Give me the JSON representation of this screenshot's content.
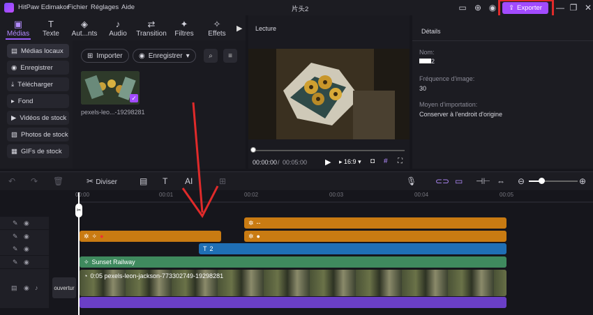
{
  "app": {
    "name": "HitPaw Edimakor",
    "menu": [
      "Fichier",
      "Réglages",
      "Aide"
    ],
    "project_title": "片头2",
    "export_label": "Exporter",
    "accent": "#a24bff",
    "highlight_color": "#e02a2a"
  },
  "media_tabs": [
    {
      "label": "Médias",
      "icon": "media-icon",
      "active": true
    },
    {
      "label": "Texte",
      "icon": "text-icon"
    },
    {
      "label": "Aut...nts",
      "icon": "auto-icon"
    },
    {
      "label": "Audio",
      "icon": "audio-icon"
    },
    {
      "label": "Transition",
      "icon": "transition-icon"
    },
    {
      "label": "Filtres",
      "icon": "filter-icon"
    },
    {
      "label": "Effets",
      "icon": "effects-icon"
    }
  ],
  "sidebar": [
    {
      "label": "Médias locaux",
      "icon": "folder-icon",
      "active": true
    },
    {
      "label": "Enregistrer",
      "icon": "record-icon"
    },
    {
      "label": "Télécharger",
      "icon": "download-icon"
    },
    {
      "label": "Fond",
      "icon": "play-icon"
    },
    {
      "label": "Vidéos de stock",
      "icon": "video-icon"
    },
    {
      "label": "Photos de stock",
      "icon": "photo-icon"
    },
    {
      "label": "GIFs de stock",
      "icon": "gif-icon"
    }
  ],
  "media_toolbar": {
    "import_label": "Importer",
    "record_label": "Enregistrer"
  },
  "media_item": {
    "name": "pexels-leo...-19298281"
  },
  "player": {
    "title": "Lecture",
    "current_time": "00:00:00",
    "separator": "/",
    "total_time": "00:05:00",
    "aspect": "16:9",
    "progress": 0
  },
  "details": {
    "title": "Détails",
    "name_label": "Nom:",
    "name_value": "2",
    "fps_label": "Fréquence d'image:",
    "fps_value": "30",
    "import_label": "Moyen d'importation:",
    "import_value": "Conserver à l'endroit d'origine"
  },
  "timeline": {
    "split_label": "Diviser",
    "ticks": [
      "00:00",
      "00:01",
      "00:02",
      "00:03",
      "00:04",
      "00:05"
    ],
    "text_clip": "2",
    "subtitle_clip": "--",
    "sticker_clip": "Sunset Railway",
    "video_clip": "0:05 pexels-leon-jackson-773302749-19298281",
    "cover_label": "ouvertur"
  }
}
